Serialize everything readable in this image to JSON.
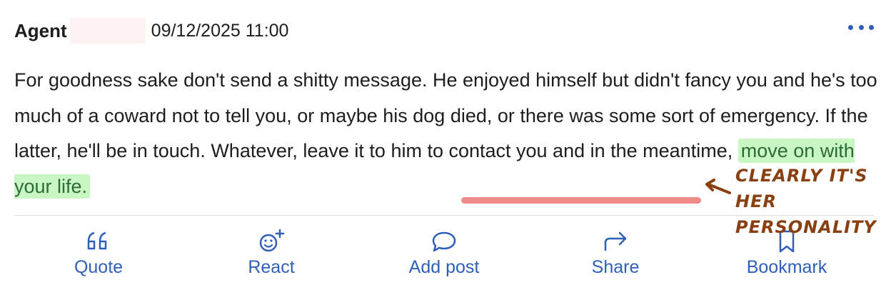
{
  "post": {
    "author": "Agent",
    "timestamp": "09/12/2025 11:00",
    "body_before": "For goodness sake don't send a shitty message. He enjoyed himself but didn't fancy you and he's too much of a coward not to tell you, or maybe his dog died, or there was some sort of emergency. If the latter, he'll be in touch. Whatever, leave it to him to contact you and in the meantime, ",
    "body_highlight": "move on with your life."
  },
  "annotation": {
    "text": "Clearly it's her personality"
  },
  "actions": [
    {
      "label": "Quote",
      "icon": "quote-icon"
    },
    {
      "label": "React",
      "icon": "react-icon"
    },
    {
      "label": "Add post",
      "icon": "chat-bubble-icon"
    },
    {
      "label": "Share",
      "icon": "share-arrow-icon"
    },
    {
      "label": "Bookmark",
      "icon": "bookmark-icon"
    }
  ],
  "colors": {
    "accent": "#2f5fb8",
    "highlight_bg": "#c9f7c4",
    "highlight_text": "#2c6b35",
    "underline": "#ee8a88",
    "annotation": "#8a3f10"
  }
}
